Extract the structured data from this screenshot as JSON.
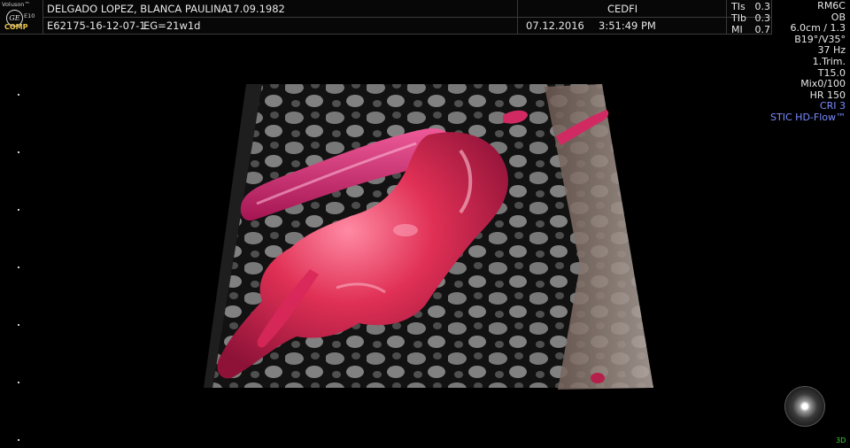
{
  "logo": {
    "brand": "Voluson™",
    "mark": "GE",
    "model": "E10",
    "comp": "COMP"
  },
  "header": {
    "patient": "DELGADO LOPEZ, BLANCA PAULINA",
    "dob": "17.09.1982",
    "exam_id": "E62175-16-12-07-1",
    "ga": "EG=21w1d",
    "institution": "CEDFI",
    "date": "07.12.2016",
    "time": "3:51:49 PM"
  },
  "safety": [
    {
      "label": "TIs",
      "value": "0.3"
    },
    {
      "label": "TIb",
      "value": "0.3"
    },
    {
      "label": "MI",
      "value": "0.7"
    }
  ],
  "params": [
    {
      "text": "RM6C",
      "highlight": false
    },
    {
      "text": "OB",
      "highlight": false
    },
    {
      "text": "6.0cm / 1.3",
      "highlight": false
    },
    {
      "text": "B19°/V35°",
      "highlight": false
    },
    {
      "text": "37 Hz",
      "highlight": false
    },
    {
      "text": "1.Trim.",
      "highlight": false
    },
    {
      "text": "T15.0",
      "highlight": false
    },
    {
      "text": "Mix0/100",
      "highlight": false
    },
    {
      "text": "HR 150",
      "highlight": false
    },
    {
      "text": "CRI 3",
      "highlight": true
    },
    {
      "text": "STIC HD-Flow™",
      "highlight": true
    }
  ],
  "mode": "3D",
  "colors": {
    "flow": "#d8285a",
    "vessel": "#c91f6a",
    "highlight_text": "#7b8cff",
    "mode_text": "#3dd43d"
  }
}
